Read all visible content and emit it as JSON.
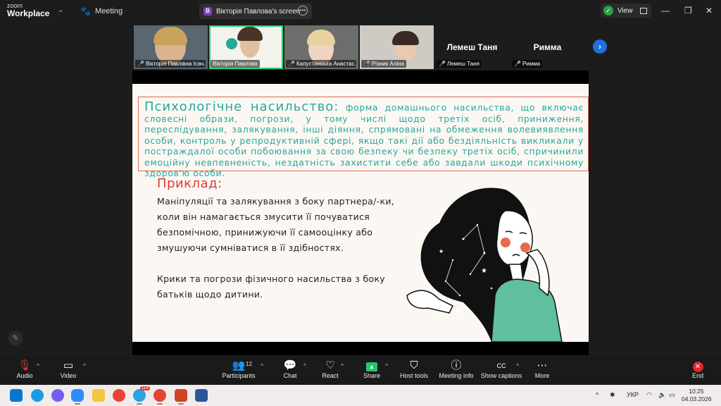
{
  "app": {
    "logo_line1": "zoom",
    "logo_line2": "Workplace",
    "meeting_label": "Meeting",
    "tab_badge": "В",
    "tab_title": "Вікторія Павлова's screen",
    "view_label": "View"
  },
  "participants": [
    {
      "label": "Вікторія Павлівна Ісач...",
      "muted": true
    },
    {
      "label": "Вікторія Павлова",
      "muted": false,
      "active": true
    },
    {
      "label": "Капустинська Анастас...",
      "muted": true
    },
    {
      "label": "Різник  Аліна",
      "muted": true
    },
    {
      "name": "Лемеш Таня",
      "label": "Лемеш Таня",
      "muted": true
    },
    {
      "name": "Римма",
      "label": "Римма",
      "muted": true
    }
  ],
  "slide": {
    "term": "Психологічне насильство:",
    "definition": " форма домашнього насильства, що включає словесні образи, погрози, у тому числі щодо третіх осіб, приниження, переслідування, залякування, інші діяння, спрямовані на обмеження волевиявлення особи, контроль у репродуктивній сфері, якщо такі дії або бездіяльність викликали у постраждалої особи побоювання за свою безпеку чи безпеку третіх осіб, спричинили емоційну невпевненість, нездатність захистити себе або завдали шкоди психічному здоров'ю особи.",
    "example_title": "Приклад:",
    "example1_lines": [
      "Маніпуляції та залякування з боку партнера/-ки,",
      "коли він намагається змусити її почуватися",
      "безпомічною, принижуючи її самооцінку або",
      "змушуючи сумніватися в її здібностях."
    ],
    "example2_lines": [
      "Крики та погрози фізичного насильства з боку",
      "батьків щодо дитини."
    ]
  },
  "toolbar": {
    "audio": "Audio",
    "video": "Video",
    "participants": "Participants",
    "participants_count": "12",
    "chat": "Chat",
    "react": "React",
    "share": "Share",
    "host_tools": "Host tools",
    "meeting_info": "Meeting info",
    "show_captions": "Show captions",
    "more": "More",
    "end": "End",
    "captions_icon_text": "CC"
  },
  "taskbar": {
    "language": "УКР",
    "time": "10:25",
    "date": "04.03.2026",
    "telegram_badge": "114"
  },
  "colors": {
    "teal": "#2aa79a",
    "red": "#e03a2f",
    "border": "#e06b4f",
    "active_green": "#27d07a"
  }
}
